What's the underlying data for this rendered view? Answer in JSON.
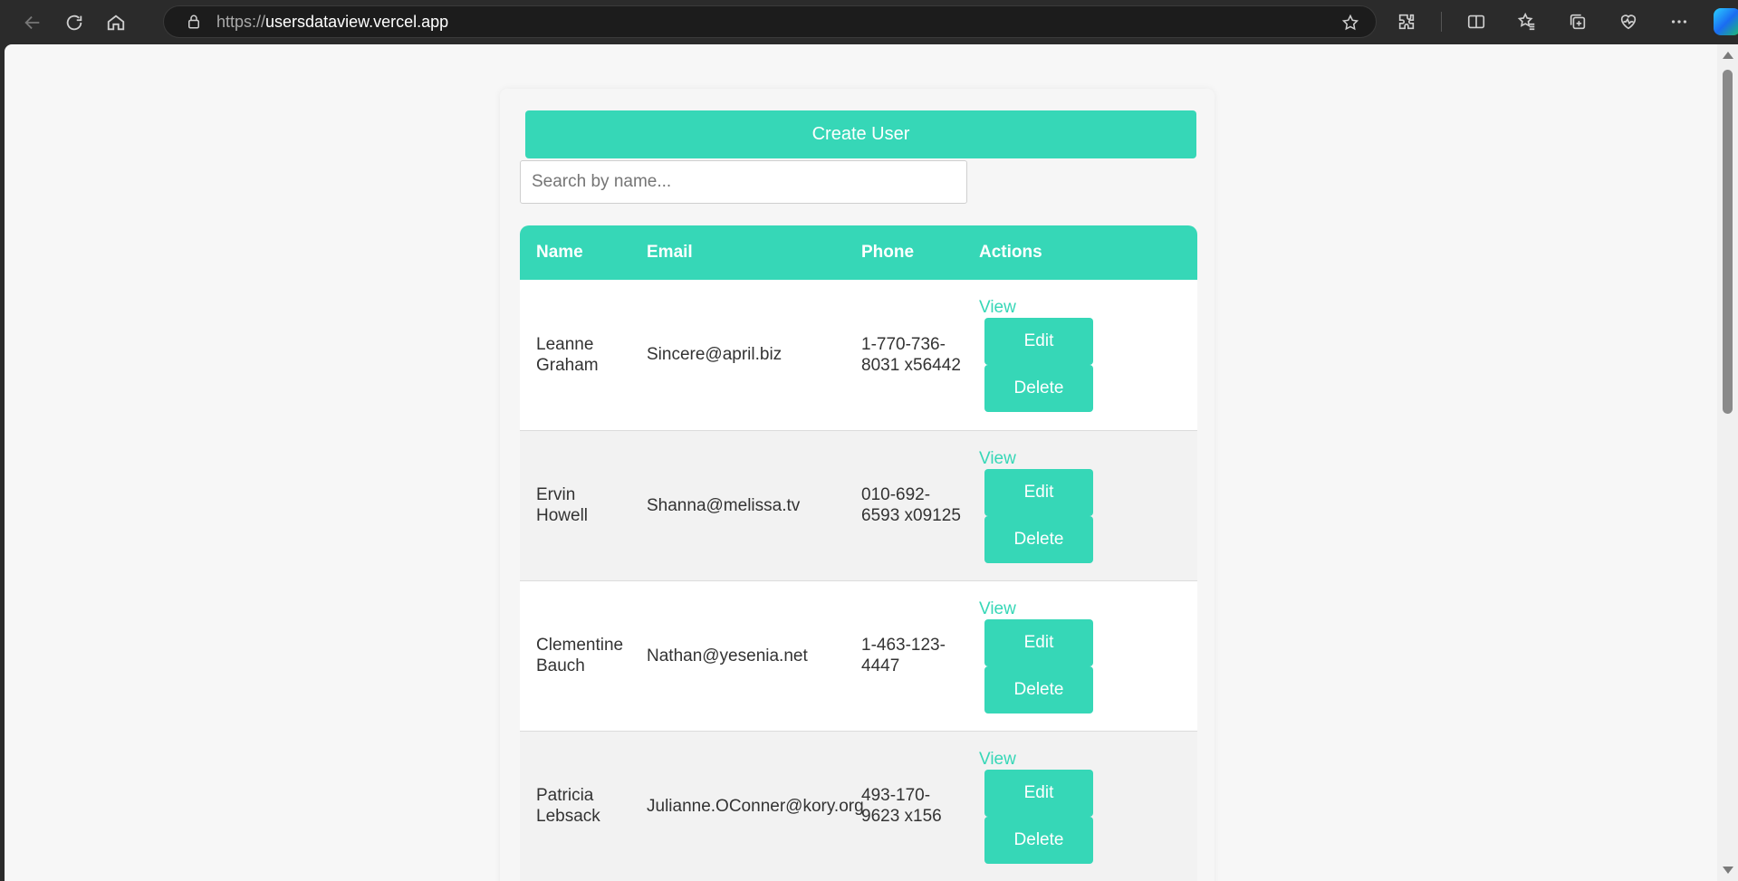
{
  "browser": {
    "url_scheme": "https://",
    "url_host": "usersdataview.vercel.app"
  },
  "app": {
    "create_button": "Create User",
    "search_placeholder": "Search by name...",
    "accent_color": "#36d7b7",
    "columns": [
      "Name",
      "Email",
      "Phone",
      "Actions"
    ],
    "view_label": "View",
    "edit_label": "Edit",
    "delete_label": "Delete",
    "rows": [
      {
        "name": "Leanne Graham",
        "email": "Sincere@april.biz",
        "phone": "1-770-736-8031 x56442"
      },
      {
        "name": "Ervin Howell",
        "email": "Shanna@melissa.tv",
        "phone": "010-692-6593 x09125"
      },
      {
        "name": "Clementine Bauch",
        "email": "Nathan@yesenia.net",
        "phone": "1-463-123-4447"
      },
      {
        "name": "Patricia Lebsack",
        "email": "Julianne.OConner@kory.org",
        "phone": "493-170-9623 x156"
      }
    ]
  }
}
